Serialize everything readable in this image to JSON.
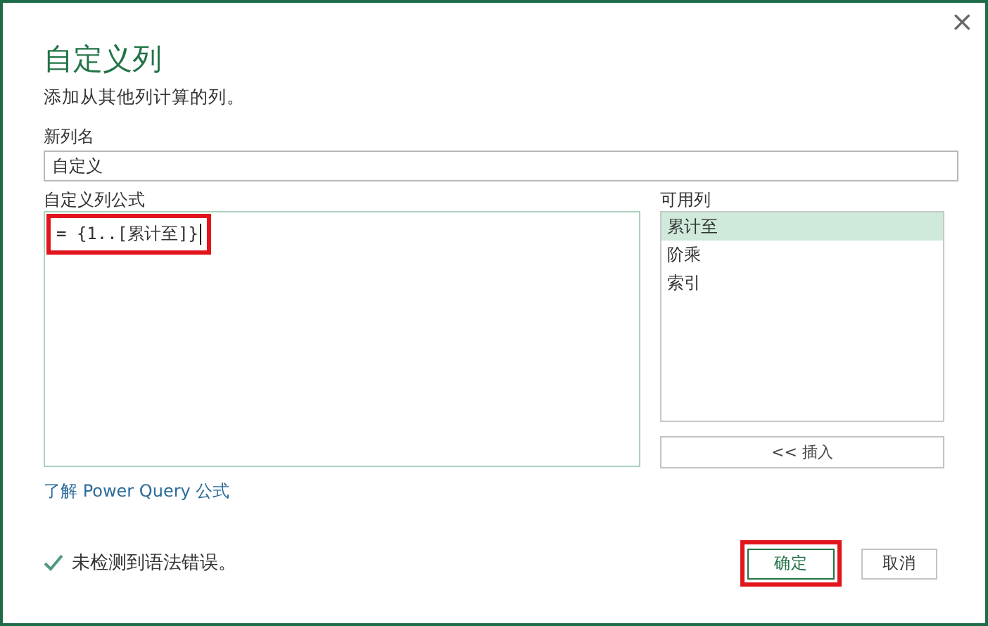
{
  "dialog": {
    "close": "×",
    "title": "自定义列",
    "subtitle": "添加从其他列计算的列。"
  },
  "name_field": {
    "label": "新列名",
    "value": "自定义"
  },
  "formula": {
    "label": "自定义列公式",
    "value": "= {1..[累计至]}",
    "highlighted": true
  },
  "available_columns": {
    "label": "可用列",
    "items": [
      {
        "label": "累计至",
        "selected": true
      },
      {
        "label": "阶乘",
        "selected": false
      },
      {
        "label": "索引",
        "selected": false
      }
    ],
    "insert_button": "<< 插入"
  },
  "help_link": "了解 Power Query 公式",
  "status": {
    "ok": true,
    "text": "未检测到语法错误。"
  },
  "buttons": [
    {
      "label": "确定",
      "kind": "primary",
      "highlighted": true
    },
    {
      "label": "取消",
      "kind": "secondary",
      "highlighted": false
    }
  ]
}
